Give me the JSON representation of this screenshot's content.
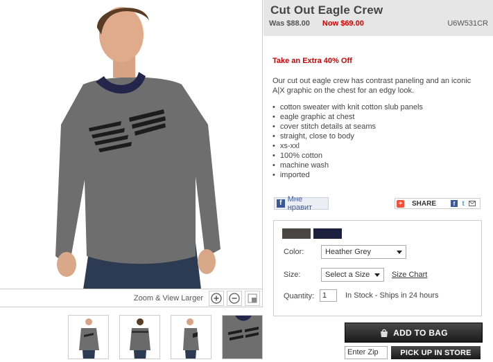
{
  "product": {
    "title": "Cut Out Eagle Crew",
    "was_price": "Was $88.00",
    "now_price": "Now $69.00",
    "sku": "U6W531CR",
    "promo": "Take an Extra 40% Off",
    "description": "Our cut out eagle crew has contrast paneling and an iconic A|X graphic on the chest for an edgy look.",
    "features": [
      "cotton sweater with knit cotton slub panels",
      "eagle graphic at chest",
      "cover stitch details at seams",
      "straight, close to body",
      "xs-xxl",
      "100% cotton",
      "machine wash",
      "imported"
    ]
  },
  "image_panel": {
    "zoom_label": "Zoom & View Larger",
    "zoom_in_icon": "zoom-in-icon",
    "zoom_out_icon": "zoom-out-icon",
    "fullscreen_icon": "fullscreen-icon",
    "thumbnail_count": 4
  },
  "social": {
    "like_label": "Мне нравит",
    "share_label": "SHARE"
  },
  "options": {
    "swatch_colors": [
      "#4a4644",
      "#1e2040"
    ],
    "color_label": "Color:",
    "color_value": "Heather Grey",
    "size_label": "Size:",
    "size_value": "Select a Size",
    "size_chart": "Size Chart",
    "quantity_label": "Quantity:",
    "quantity_value": "1",
    "stock_text": "In Stock - Ships in 24 hours"
  },
  "actions": {
    "add_to_bag": "ADD TO BAG",
    "zip_placeholder": "Enter Zip",
    "pickup": "PICK UP IN STORE"
  },
  "colors": {
    "sale_red": "#d00000",
    "header_gray": "#e6e6e6",
    "button_dark": "#1a1a1a"
  }
}
